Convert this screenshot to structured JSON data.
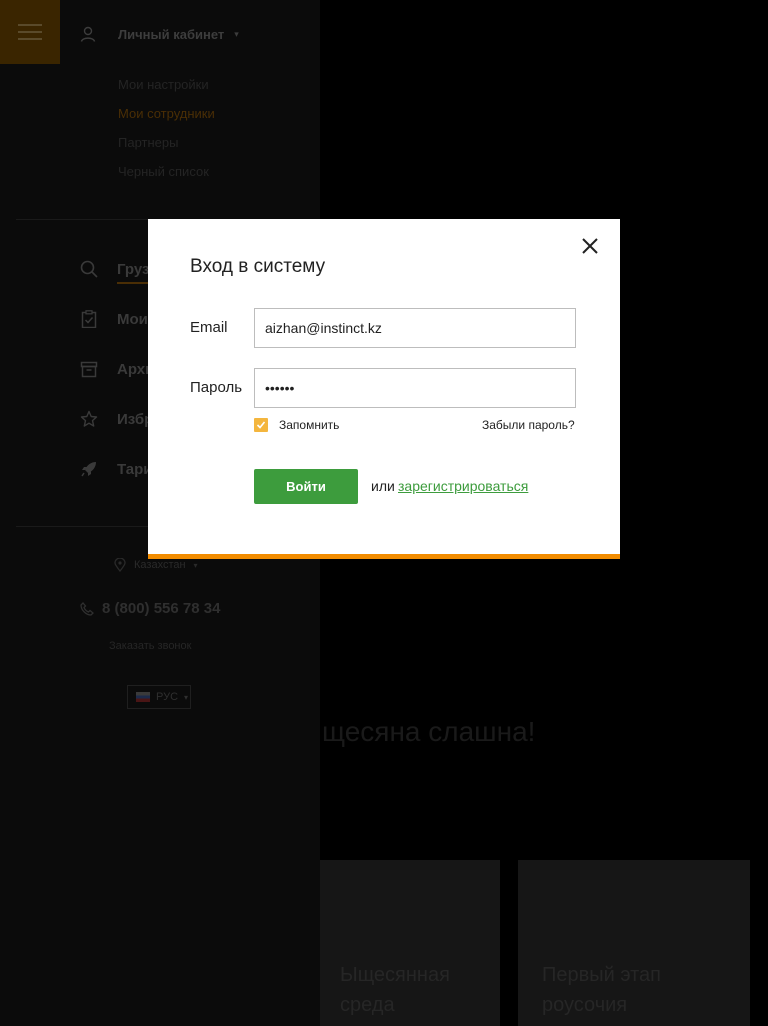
{
  "sidebar": {
    "cabinet_label": "Личный кабинет",
    "sub_items": [
      "Мои настройки",
      "Мои сотрудники",
      "Партнеры",
      "Черный список"
    ],
    "nav_items": [
      {
        "label": "Грузы",
        "icon": "search-icon"
      },
      {
        "label": "Мои",
        "icon": "clipboard-icon"
      },
      {
        "label": "Архив",
        "icon": "archive-icon"
      },
      {
        "label": "Избранное",
        "icon": "star-icon"
      },
      {
        "label": "Тарифы",
        "icon": "rocket-icon"
      }
    ],
    "country": "Казахстан",
    "phone": "8 (800) 556 78 34",
    "callback": "Заказать звонок",
    "language": "РУС"
  },
  "background": {
    "heading": "щесяна слашна!",
    "card1_title": "Ыщесянная\nсреда",
    "card2_title": "Первый этап\nроусочия"
  },
  "modal": {
    "title": "Вход в систему",
    "email_label": "Email",
    "email_value": "aizhan@instinct.kz",
    "password_label": "Пароль",
    "password_value": "••••••",
    "remember_label": "Запомнить",
    "forgot_label": "Забыли пароль?",
    "login_button": "Войти",
    "or_text": "или",
    "register_link": "зарегистрироваться"
  },
  "colors": {
    "accent": "#f28c00",
    "button": "#3d9c3d",
    "checkbox": "#f4b63e"
  }
}
